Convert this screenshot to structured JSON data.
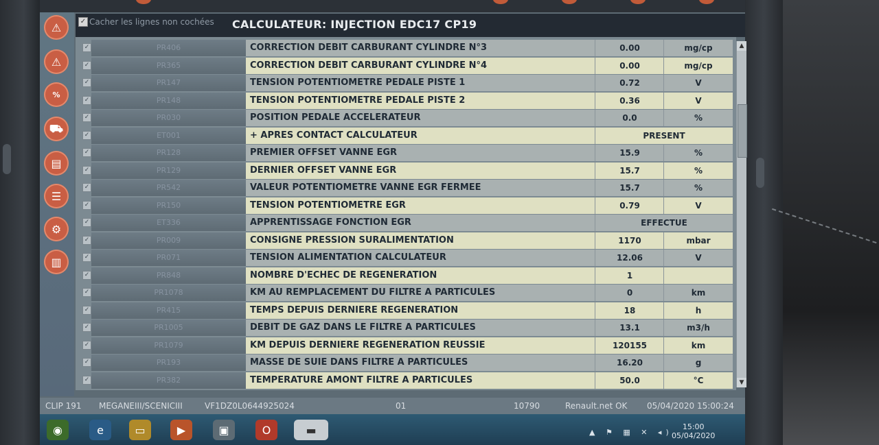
{
  "header": {
    "filter_label": "Cacher les lignes non cochées",
    "title": "CALCULATEUR: INJECTION EDC17 CP19"
  },
  "colors": {
    "accent": "#c95e44",
    "row_light": "#dfe0c2",
    "row_dark": "#a9b1b1"
  },
  "sidebar_icons": [
    "warning-icon",
    "warning-icon",
    "percent-icon",
    "car-icon",
    "book-icon",
    "list-icon",
    "car-service-icon",
    "barcode-icon"
  ],
  "rows": [
    {
      "code": "PR406",
      "label": "CORRECTION DEBIT CARBURANT CYLINDRE N°3",
      "value": "0.00",
      "unit": "mg/cp"
    },
    {
      "code": "PR365",
      "label": "CORRECTION DEBIT CARBURANT CYLINDRE N°4",
      "value": "0.00",
      "unit": "mg/cp"
    },
    {
      "code": "PR147",
      "label": "TENSION POTENTIOMETRE PEDALE PISTE 1",
      "value": "0.72",
      "unit": "V"
    },
    {
      "code": "PR148",
      "label": "TENSION POTENTIOMETRE PEDALE PISTE 2",
      "value": "0.36",
      "unit": "V"
    },
    {
      "code": "PR030",
      "label": "POSITION PEDALE ACCELERATEUR",
      "value": "0.0",
      "unit": "%"
    },
    {
      "code": "ET001",
      "label": "+ APRES CONTACT CALCULATEUR",
      "status": "PRESENT"
    },
    {
      "code": "PR128",
      "label": "PREMIER OFFSET VANNE EGR",
      "value": "15.9",
      "unit": "%"
    },
    {
      "code": "PR129",
      "label": "DERNIER OFFSET VANNE EGR",
      "value": "15.7",
      "unit": "%"
    },
    {
      "code": "PR542",
      "label": "VALEUR POTENTIOMETRE VANNE EGR FERMEE",
      "value": "15.7",
      "unit": "%"
    },
    {
      "code": "PR150",
      "label": "TENSION POTENTIOMETRE EGR",
      "value": "0.79",
      "unit": "V"
    },
    {
      "code": "ET336",
      "label": "APPRENTISSAGE FONCTION EGR",
      "status": "EFFECTUE"
    },
    {
      "code": "PR009",
      "label": "CONSIGNE PRESSION SURALIMENTATION",
      "value": "1170",
      "unit": "mbar"
    },
    {
      "code": "PR071",
      "label": "TENSION ALIMENTATION CALCULATEUR",
      "value": "12.06",
      "unit": "V"
    },
    {
      "code": "PR848",
      "label": "NOMBRE D'ECHEC DE REGENERATION",
      "value": "1",
      "unit": ""
    },
    {
      "code": "PR1078",
      "label": "KM AU REMPLACEMENT DU FILTRE A PARTICULES",
      "value": "0",
      "unit": "km"
    },
    {
      "code": "PR415",
      "label": "TEMPS DEPUIS DERNIERE REGENERATION",
      "value": "18",
      "unit": "h"
    },
    {
      "code": "PR1005",
      "label": "DEBIT DE GAZ DANS LE FILTRE A PARTICULES",
      "value": "13.1",
      "unit": "m3/h"
    },
    {
      "code": "PR1079",
      "label": "KM DEPUIS DERNIERE REGENERATION REUSSIE",
      "value": "120155",
      "unit": "km"
    },
    {
      "code": "PR193",
      "label": "MASSE DE SUIE DANS FILTRE A PARTICULES",
      "value": "16.20",
      "unit": "g"
    },
    {
      "code": "PR382",
      "label": "TEMPERATURE AMONT FILTRE A PARTICULES",
      "value": "50.0",
      "unit": "°C"
    }
  ],
  "statusbar": {
    "clip": "CLIP 191",
    "vehicle": "MEGANEIII/SCENICIII",
    "vin": "VF1DZ0L0644925024",
    "page": "01",
    "code": "10790",
    "network": "Renault.net OK",
    "datetime": "05/04/2020 15:00:24"
  },
  "taskbar": {
    "time": "15:00",
    "date": "05/04/2020"
  }
}
